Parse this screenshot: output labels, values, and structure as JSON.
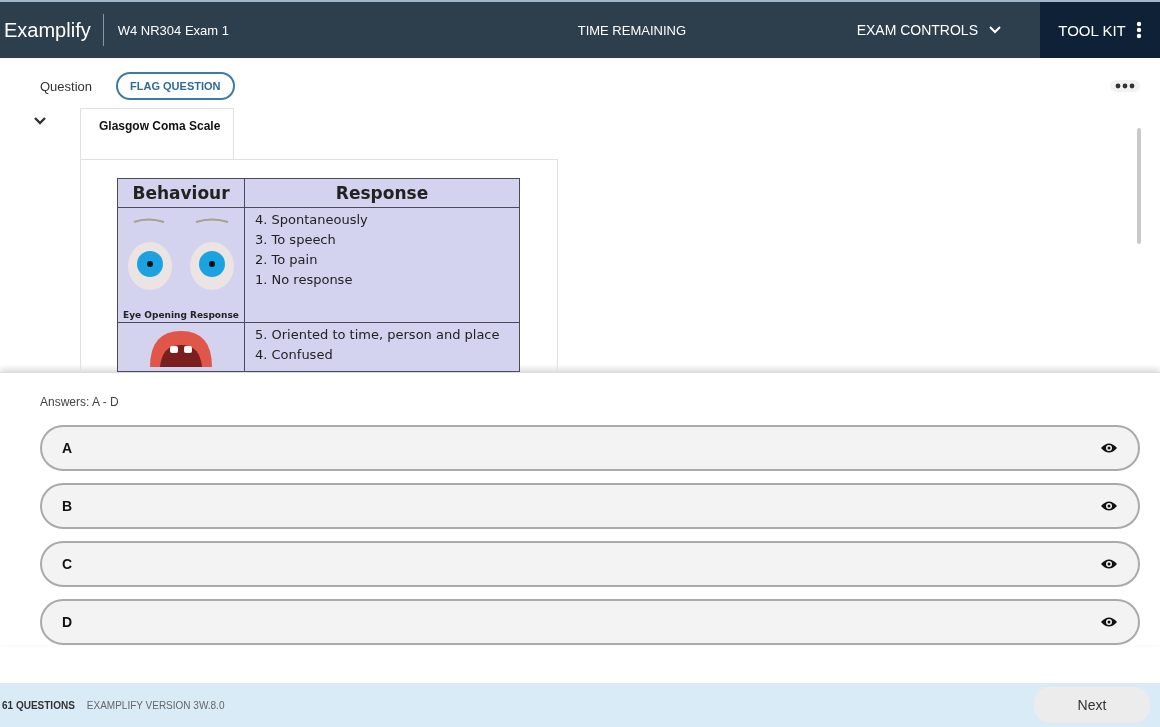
{
  "header": {
    "logo": "Examplify",
    "exam_title": "W4 NR304 Exam 1",
    "timer_label": "TIME REMAINING",
    "exam_controls": "EXAM CONTROLS",
    "tool_kit": "TOOL KIT"
  },
  "question": {
    "label": "Question",
    "flag_button": "FLAG QUESTION",
    "expanded": true,
    "tab": "Glasgow Coma Scale",
    "table": {
      "columns": [
        "Behaviour",
        "Response"
      ],
      "rows": [
        {
          "kind": "eyes",
          "caption": "Eye Opening Response",
          "responses": [
            "4. Spontaneously",
            "3. To speech",
            "2. To pain",
            "1. No response"
          ]
        },
        {
          "kind": "mouth",
          "responses": [
            "5. Oriented to time, person and place",
            "4. Confused"
          ]
        }
      ]
    }
  },
  "answers": {
    "label": "Answers: A - D",
    "options": [
      {
        "letter": "A"
      },
      {
        "letter": "B"
      },
      {
        "letter": "C"
      },
      {
        "letter": "D"
      }
    ]
  },
  "footer": {
    "question_count": "61 QUESTIONS",
    "version": "EXAMPLIFY VERSION 3W.8.0",
    "next_button": "Next"
  }
}
